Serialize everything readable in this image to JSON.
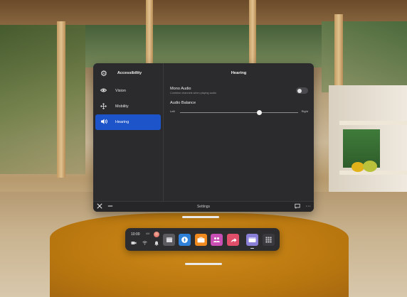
{
  "sidebar": {
    "header": {
      "title": "Accessibility",
      "icon": "gear-icon"
    },
    "items": [
      {
        "label": "Vision",
        "icon": "eye-icon",
        "active": false
      },
      {
        "label": "Mobility",
        "icon": "move-arrows-icon",
        "active": false
      },
      {
        "label": "Hearing",
        "icon": "speaker-icon",
        "active": true
      }
    ]
  },
  "content": {
    "title": "Hearing",
    "mono_audio": {
      "label": "Mono Audio",
      "description": "Combine channels when playing audio",
      "enabled": false
    },
    "audio_balance": {
      "label": "Audio Balance",
      "left_label": "Left",
      "right_label": "Right",
      "value": 0.67
    }
  },
  "bottom_bar": {
    "label": "Settings"
  },
  "dock": {
    "time": "10:00",
    "ampm": "AM",
    "apps": [
      {
        "name": "store",
        "icon": "store-icon",
        "color": "#5a5a5f"
      },
      {
        "name": "explore",
        "icon": "compass-icon",
        "color": "#2f80d8"
      },
      {
        "name": "work",
        "icon": "briefcase-icon",
        "color": "#f08a1f"
      },
      {
        "name": "people",
        "icon": "people-icon",
        "color": "#c94fb5"
      },
      {
        "name": "share",
        "icon": "share-icon",
        "color": "#e14e6a"
      },
      {
        "name": "settings-window",
        "icon": "window-icon",
        "color": "#8a7fd6"
      },
      {
        "name": "app-library",
        "icon": "grid-icon",
        "color": "#3a3a3e"
      }
    ]
  },
  "colors": {
    "accent": "#1d54c9",
    "panel": "#2b2b2d"
  }
}
